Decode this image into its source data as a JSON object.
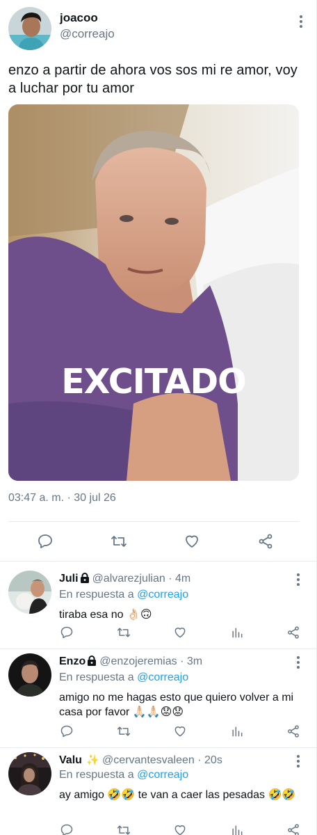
{
  "tweet": {
    "display_name": "joacoo",
    "handle": "@correajo",
    "text": "enzo a partir de ahora vos sos mi re amor, voy a luchar por tu amor",
    "media_caption": "EXCITADO",
    "timestamp": "03:47 a. m. · 30 jul 26",
    "icons": [
      "reply-icon",
      "retweet-icon",
      "like-icon",
      "share-icon"
    ]
  },
  "replies": [
    {
      "name": "Juli",
      "handle": "@alvarezjulian",
      "time": "4m",
      "in_reply_prefix": "En respuesta a",
      "in_reply_to": "@correajo",
      "text": "tiraba esa no 👌🏻🙃",
      "protected": true
    },
    {
      "name": "Enzo",
      "handle": "@enzojeremias",
      "time": "3m",
      "in_reply_prefix": "En respuesta a",
      "in_reply_to": "@correajo",
      "text": "amigo no me hagas esto que quiero volver a mi casa por favor 🙏🏻🙏🏻😟😟",
      "protected": true
    },
    {
      "name": "Valu",
      "handle": "@cervantesvaleen",
      "time": "20s",
      "in_reply_prefix": "En respuesta a",
      "in_reply_to": "@correajo",
      "text": "ay amigo 🤣🤣 te van a caer las pesadas 🤣🤣",
      "badge": "✨"
    }
  ],
  "colors": {
    "accent": "#1da1f2",
    "secondary": "#657786",
    "divider": "#e6ecf0",
    "text": "#0f1419"
  }
}
